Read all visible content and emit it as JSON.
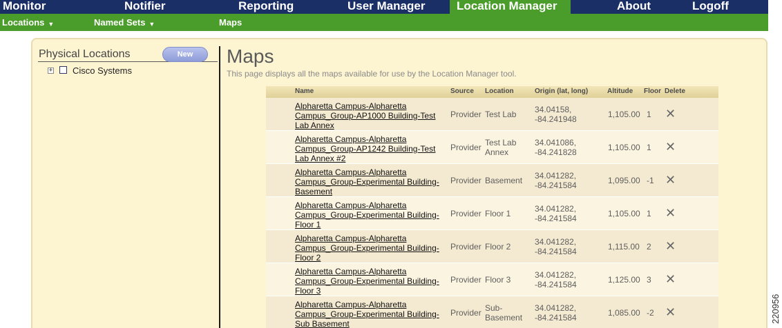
{
  "topnav": {
    "items": [
      {
        "label": "Monitor",
        "active": false
      },
      {
        "label": "Notifier",
        "active": false
      },
      {
        "label": "Reporting",
        "active": false
      },
      {
        "label": "User Manager",
        "active": false
      },
      {
        "label": "Location Manager",
        "active": true
      },
      {
        "label": "About",
        "active": false
      },
      {
        "label": "Logoff",
        "active": false
      }
    ]
  },
  "subnav": {
    "items": [
      {
        "label": "Locations",
        "dropdown": true
      },
      {
        "label": "Named Sets",
        "dropdown": true
      },
      {
        "label": "Maps",
        "dropdown": false
      }
    ],
    "dropdown_glyph": "▼"
  },
  "left": {
    "title": "Physical Locations",
    "new_label": "New",
    "tree": {
      "expand_glyph": "+",
      "label": "Cisco Systems"
    }
  },
  "maps": {
    "title": "Maps",
    "description": "This page displays all the maps available for use by the Location Manager tool.",
    "headers": {
      "name": "Name",
      "source": "Source",
      "location": "Location",
      "origin": "Origin (lat, long)",
      "altitude": "Altitude",
      "floor": "Floor",
      "delete": "Delete"
    },
    "delete_glyph": "✕",
    "rows": [
      {
        "name": "Alpharetta Campus-Alpharetta Campus_Group-AP1000 Building-Test Lab Annex",
        "source": "Provider",
        "location": "Test Lab",
        "origin": "34.04158, -84.241948",
        "altitude": "1,105.00",
        "floor": "1"
      },
      {
        "name": "Alpharetta Campus-Alpharetta Campus_Group-AP1242 Building-Test Lab Annex #2",
        "source": "Provider",
        "location": "Test Lab Annex",
        "origin": "34.041086, -84.241828",
        "altitude": "1,105.00",
        "floor": "1"
      },
      {
        "name": "Alpharetta Campus-Alpharetta Campus_Group-Experimental Building-Basement",
        "source": "Provider",
        "location": "Basement",
        "origin": "34.041282, -84.241584",
        "altitude": "1,095.00",
        "floor": "-1"
      },
      {
        "name": "Alpharetta Campus-Alpharetta Campus_Group-Experimental Building-Floor 1",
        "source": "Provider",
        "location": "Floor 1",
        "origin": "34.041282, -84.241584",
        "altitude": "1,105.00",
        "floor": "1"
      },
      {
        "name": "Alpharetta Campus-Alpharetta Campus_Group-Experimental Building-Floor 2",
        "source": "Provider",
        "location": "Floor 2",
        "origin": "34.041282, -84.241584",
        "altitude": "1,115.00",
        "floor": "2"
      },
      {
        "name": "Alpharetta Campus-Alpharetta Campus_Group-Experimental Building-Floor 3",
        "source": "Provider",
        "location": "Floor 3",
        "origin": "34.041282, -84.241584",
        "altitude": "1,125.00",
        "floor": "3"
      },
      {
        "name": "Alpharetta Campus-Alpharetta Campus_Group-Experimental Building-Sub Basement",
        "source": "Provider",
        "location": "Sub-Basement",
        "origin": "34.041282, -84.241584",
        "altitude": "1,085.00",
        "floor": "-2"
      }
    ]
  },
  "figure_id": "220956",
  "colors": {
    "nav_bg": "#1a2f66",
    "nav_active": "#4a9d2a",
    "subnav_bg": "#4a9d2a",
    "panel_bg": "#fdf4d2"
  }
}
